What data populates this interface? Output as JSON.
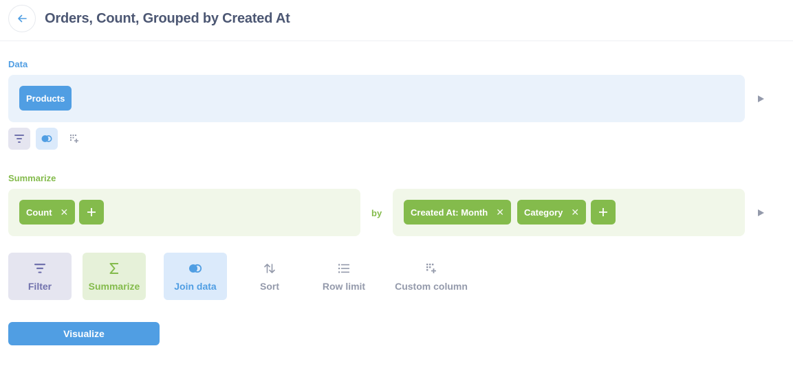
{
  "header": {
    "title": "Orders, Count, Grouped by Created At"
  },
  "data_section": {
    "label": "Data",
    "source": "Products"
  },
  "summarize_section": {
    "label": "Summarize",
    "metrics": [
      {
        "label": "Count"
      }
    ],
    "by_label": "by",
    "breakouts": [
      {
        "label": "Created At: Month"
      },
      {
        "label": "Category"
      }
    ]
  },
  "actions": {
    "filter": "Filter",
    "summarize": "Summarize",
    "join": "Join data",
    "sort": "Sort",
    "row_limit": "Row limit",
    "custom_column": "Custom column"
  },
  "visualize_label": "Visualize",
  "icons": {
    "back": "arrow-left-icon",
    "run": "play-icon",
    "filter": "filter-icon",
    "join": "join-icon",
    "custom_column": "custom-column-icon",
    "summarize": "sigma-icon",
    "sort": "sort-icon",
    "row_limit": "list-icon",
    "remove": "close-icon",
    "add": "plus-icon"
  },
  "colors": {
    "brand": "#509ee3",
    "summarize": "#84bb4c",
    "filter": "#7172ad",
    "data_bg": "#eaf2fb",
    "summarize_bg": "#f1f7e9",
    "filter_bg": "#e5e5f0",
    "muted": "#949aab"
  }
}
